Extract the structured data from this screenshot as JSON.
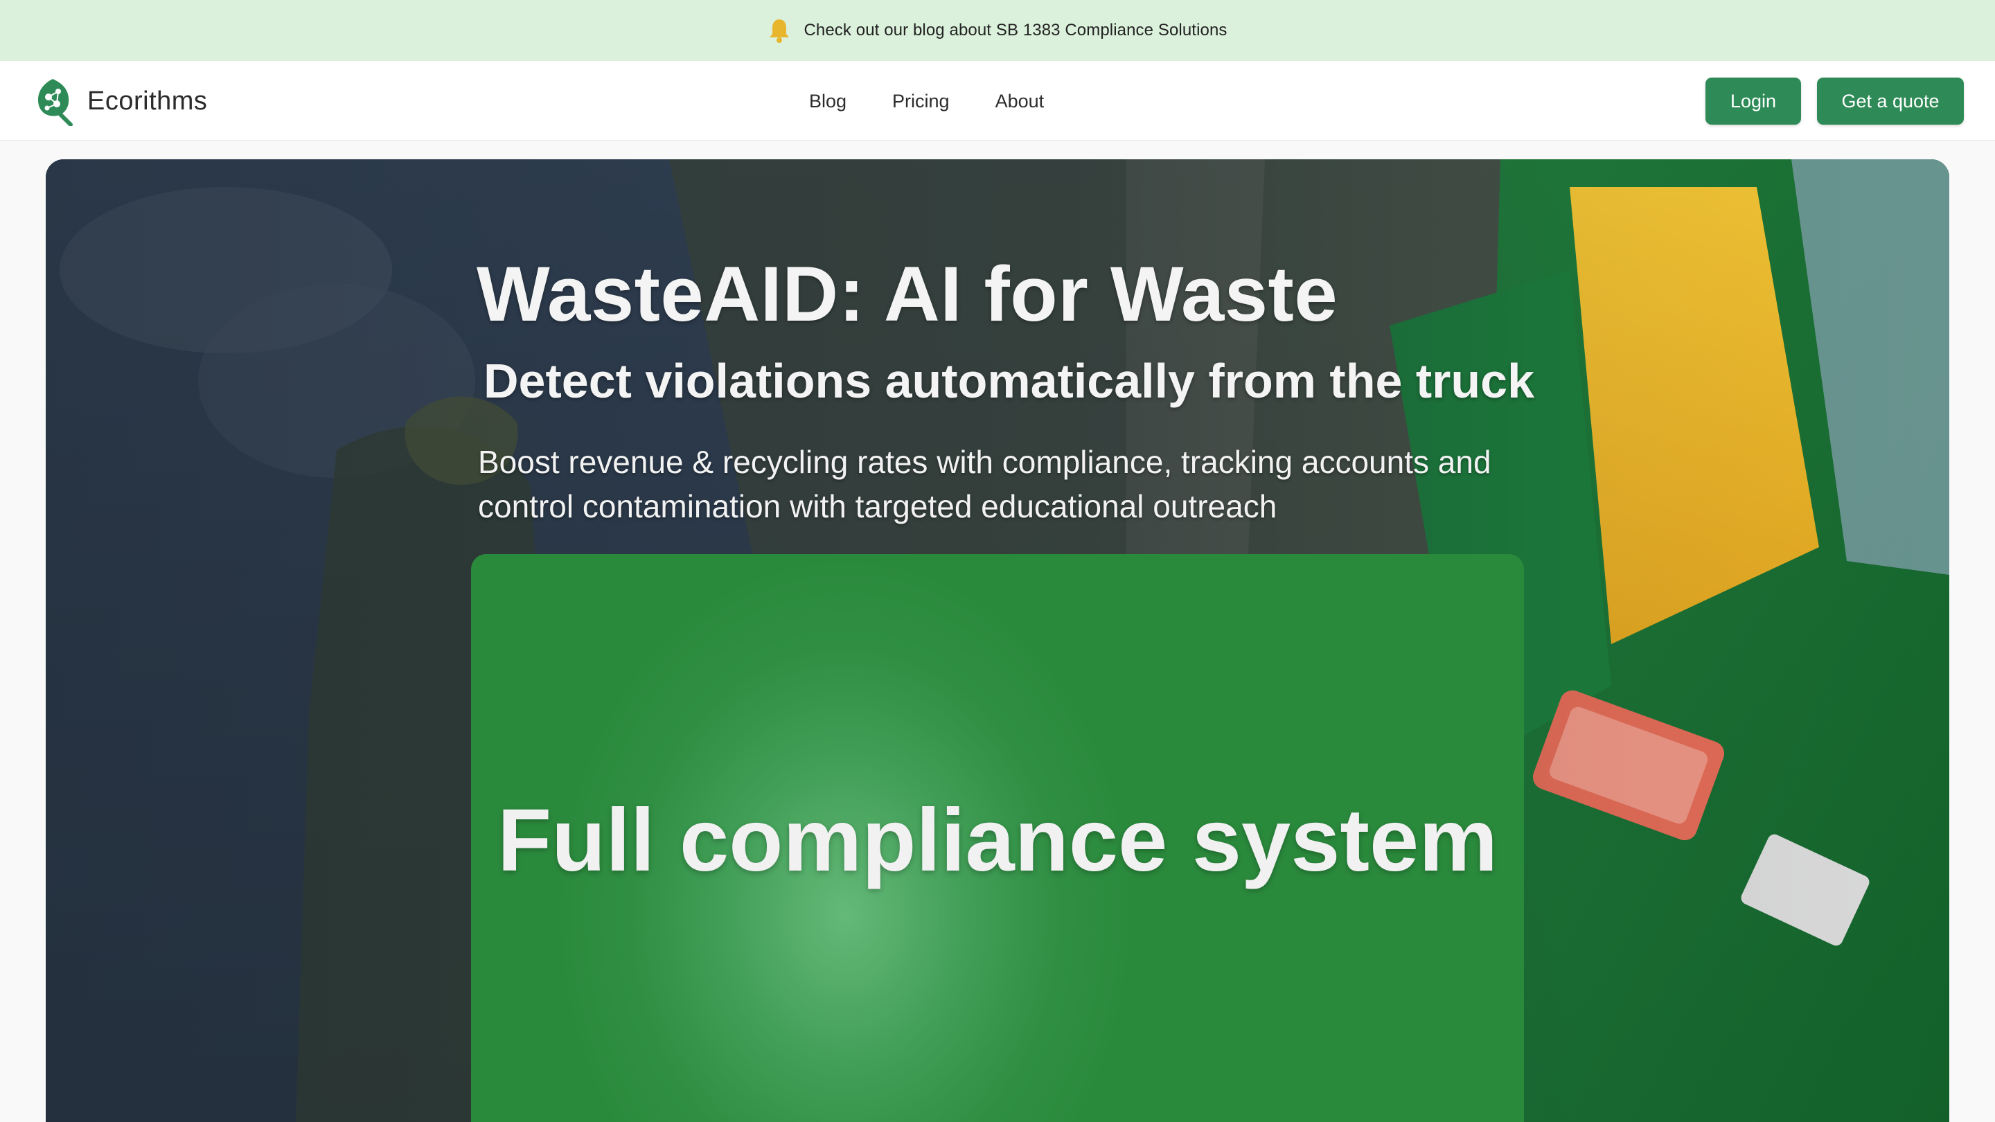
{
  "announcement": {
    "icon": "bell-icon",
    "icon_color": "#e7b62c",
    "text": "Check out our blog about SB 1383  Compliance Solutions"
  },
  "nav": {
    "brand": "Ecorithms",
    "links": [
      "Blog",
      "Pricing",
      "About"
    ],
    "login_label": "Login",
    "quote_label": "Get a quote",
    "accent_color": "#2e8b57"
  },
  "hero": {
    "title": "WasteAID: AI for Waste",
    "subtitle": "Detect violations automatically from the truck",
    "description": "Boost revenue & recycling rates with compliance, tracking accounts and control contamination with targeted educational outreach",
    "card_title": "Full compliance system"
  }
}
